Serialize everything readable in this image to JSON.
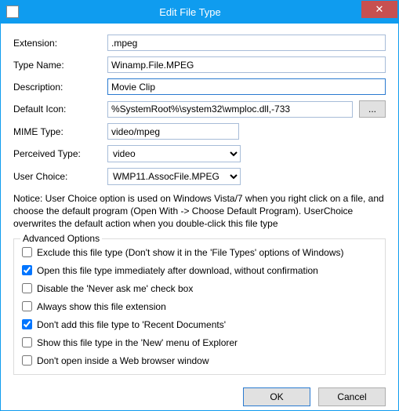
{
  "window": {
    "title": "Edit File Type",
    "close_symbol": "✕"
  },
  "form": {
    "extension_label": "Extension:",
    "extension_value": ".mpeg",
    "typename_label": "Type Name:",
    "typename_value": "Winamp.File.MPEG",
    "description_label": "Description:",
    "description_value": "Movie Clip",
    "defaulticon_label": "Default Icon:",
    "defaulticon_value": "%SystemRoot%\\system32\\wmploc.dll,-733",
    "browse_label": "...",
    "mimetype_label": "MIME Type:",
    "mimetype_value": "video/mpeg",
    "perceivedtype_label": "Perceived Type:",
    "perceivedtype_value": "video",
    "userchoice_label": "User Choice:",
    "userchoice_value": "WMP11.AssocFile.MPEG"
  },
  "notice": "Notice: User Choice option is used on Windows Vista/7 when you right click on a file, and choose the default program (Open With -> Choose Default Program). UserChoice overwrites the default action when you double-click this file type",
  "advanced": {
    "legend": "Advanced Options",
    "options": [
      {
        "label": "Exclude  this file type (Don't show it in the 'File Types' options of Windows)",
        "checked": false
      },
      {
        "label": "Open this file type immediately after download, without confirmation",
        "checked": true
      },
      {
        "label": "Disable the 'Never ask me' check box",
        "checked": false
      },
      {
        "label": "Always show this file extension",
        "checked": false
      },
      {
        "label": "Don't add this file type to 'Recent Documents'",
        "checked": true
      },
      {
        "label": "Show this file type in the 'New' menu of Explorer",
        "checked": false
      },
      {
        "label": "Don't open inside a Web browser window",
        "checked": false
      }
    ]
  },
  "buttons": {
    "ok": "OK",
    "cancel": "Cancel"
  }
}
